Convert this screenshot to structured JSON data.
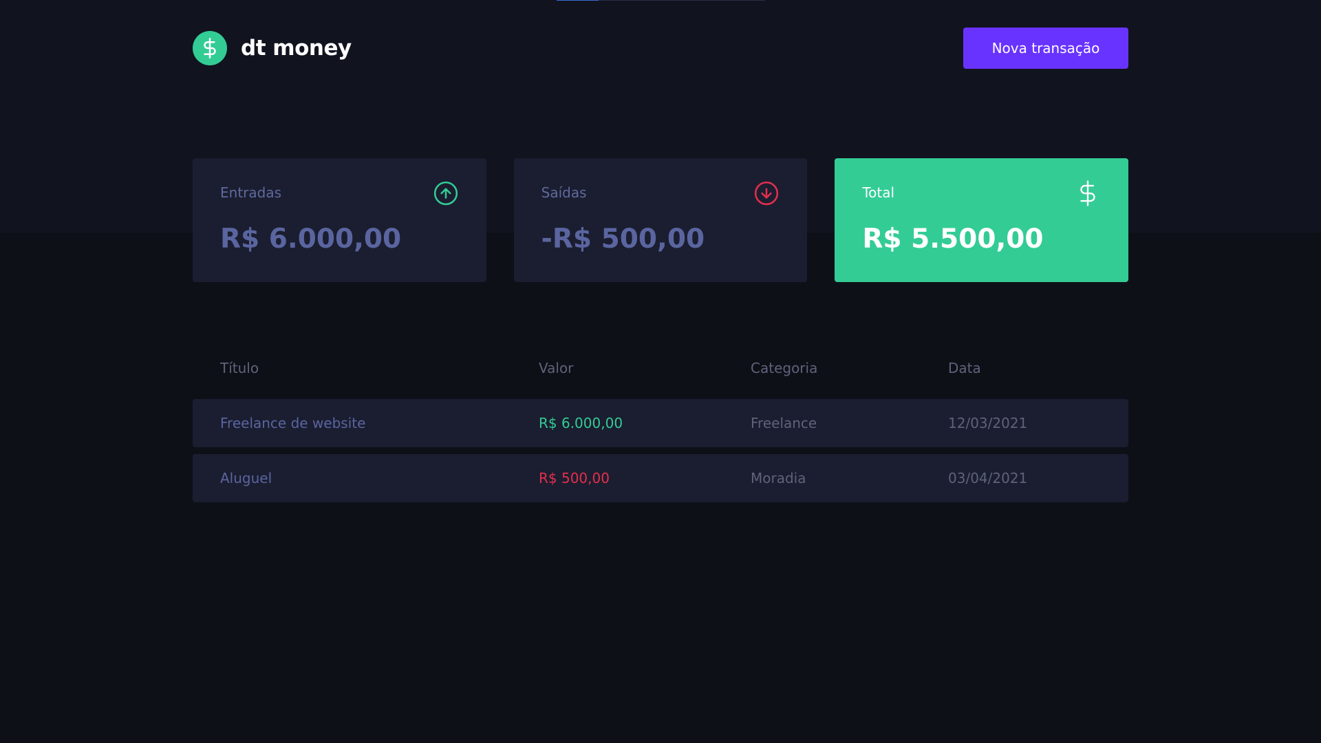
{
  "app": {
    "name": "dt money",
    "logo_icon": "dollar-sign-icon"
  },
  "header": {
    "new_transaction_label": "Nova transação"
  },
  "loading_progress": 0.2,
  "summary": {
    "income": {
      "label": "Entradas",
      "value": "R$ 6.000,00",
      "icon": "arrow-up-circle-icon"
    },
    "outcome": {
      "label": "Saídas",
      "value": "-R$ 500,00",
      "icon": "arrow-down-circle-icon"
    },
    "total": {
      "label": "Total",
      "value": "R$ 5.500,00",
      "icon": "dollar-sign-icon"
    }
  },
  "table": {
    "columns": [
      "Título",
      "Valor",
      "Categoria",
      "Data"
    ],
    "rows": [
      {
        "title": "Freelance de website",
        "amount": "R$ 6.000,00",
        "type": "deposit",
        "category": "Freelance",
        "date": "12/03/2021"
      },
      {
        "title": "Aluguel",
        "amount": "R$ 500,00",
        "type": "withdraw",
        "category": "Moradia",
        "date": "03/04/2021"
      }
    ]
  },
  "colors": {
    "background": "#0e1018",
    "card": "#1b1e30",
    "green": "#33cc95",
    "red": "#e52e4d",
    "purple": "#6933ff"
  }
}
